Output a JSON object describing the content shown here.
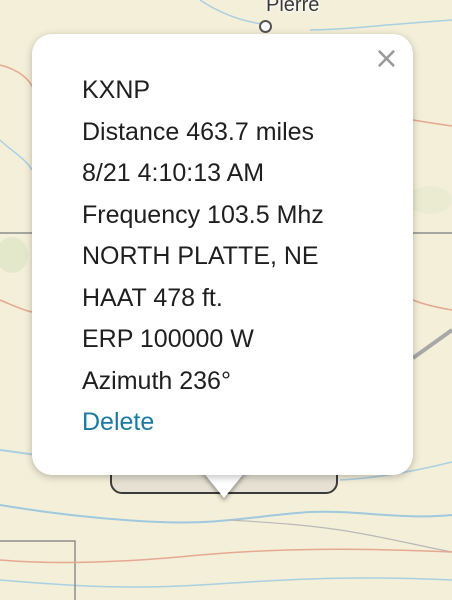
{
  "map": {
    "city_label": "Pierre"
  },
  "popup": {
    "close_symbol": "×",
    "callsign": "KXNP",
    "distance": "Distance 463.7 miles",
    "datetime": "8/21 4:10:13 AM",
    "frequency": "Frequency 103.5 Mhz",
    "location": "NORTH PLATTE, NE",
    "haat": "HAAT 478 ft.",
    "erp": "ERP 100000 W",
    "azimuth": "Azimuth 236°",
    "delete_label": "Delete"
  },
  "colors": {
    "map_background": "#f4efd9",
    "link": "#1a7aa0",
    "text": "#1f1f1f"
  }
}
